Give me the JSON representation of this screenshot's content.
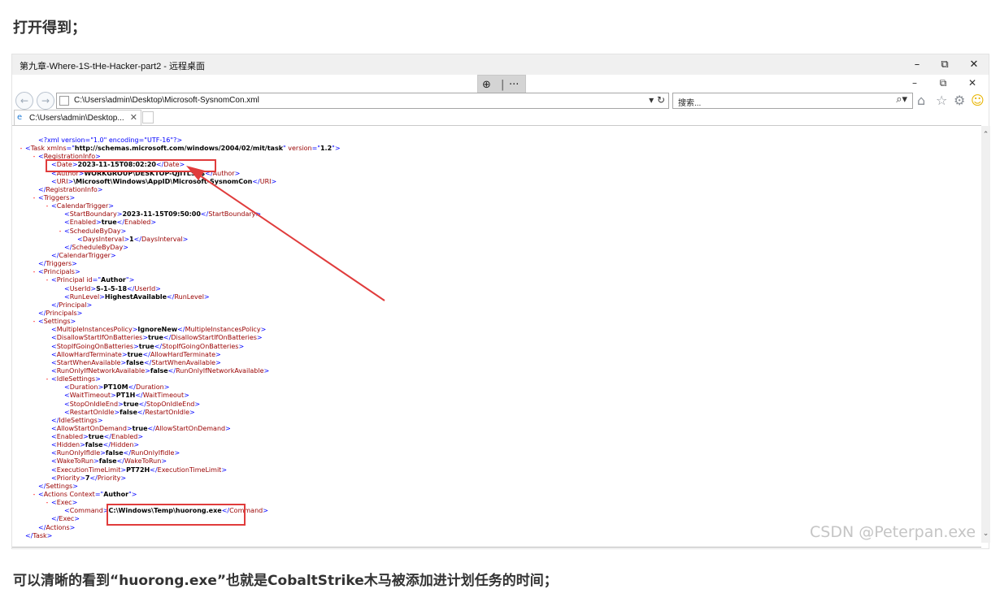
{
  "heading": "打开得到；",
  "footer": "可以清晰的看到“huorong.exe”也就是CobaltStrike木马被添加进计划任务的时间；",
  "watermark": "CSDN @Peterpan.exe",
  "remote_desktop": {
    "title": "第九章-Where-1S-tHe-Hacker-part2 - 远程桌面",
    "controls": {
      "minimize": "–",
      "restore": "⧉",
      "close": "✕"
    },
    "toolbar": {
      "zoom_icon": "⊕",
      "separator": "|",
      "more": "···"
    }
  },
  "browser": {
    "controls": {
      "minimize": "–",
      "restore": "⧉",
      "close": "✕"
    },
    "address": "C:\\Users\\admin\\Desktop\\Microsoft-SysnomCon.xml",
    "search_placeholder": "搜索...",
    "tab_label": "C:\\Users\\admin\\Desktop...",
    "icons": [
      "back-icon",
      "forward-icon",
      "refresh-icon",
      "search-icon",
      "home-icon",
      "favorites-icon",
      "gear-icon",
      "smiley-icon"
    ]
  },
  "colors": {
    "tag": "#990000",
    "bracket": "#0000ff",
    "marker": "#ff0000",
    "highlight": "#e03c3c"
  },
  "xml_lines": [
    {
      "indent": 1,
      "marker": "",
      "segs": [
        [
          "pi",
          "<?xml version=\"1.0\" encoding=\"UTF-16\"?>"
        ]
      ]
    },
    {
      "indent": 0,
      "marker": "-",
      "segs": [
        [
          "br",
          "<"
        ],
        [
          "tag",
          "Task xmlns"
        ],
        [
          "br",
          "=\""
        ],
        [
          "val",
          "http://schemas.microsoft.com/windows/2004/02/mit/task"
        ],
        [
          "br",
          "\" "
        ],
        [
          "tag",
          "version"
        ],
        [
          "br",
          "=\""
        ],
        [
          "val",
          "1.2"
        ],
        [
          "br",
          "\">"
        ]
      ]
    },
    {
      "indent": 1,
      "marker": "-",
      "segs": [
        [
          "br",
          "<"
        ],
        [
          "tag",
          "RegistrationInfo"
        ],
        [
          "br",
          ">"
        ]
      ]
    },
    {
      "indent": 2,
      "marker": "",
      "segs": [
        [
          "br",
          "<"
        ],
        [
          "tag",
          "Date"
        ],
        [
          "br",
          ">"
        ],
        [
          "val",
          "2023-11-15T08:02:20"
        ],
        [
          "br",
          "</"
        ],
        [
          "tag",
          "Date"
        ],
        [
          "br",
          ">"
        ]
      ]
    },
    {
      "indent": 2,
      "marker": "",
      "segs": [
        [
          "br",
          "<"
        ],
        [
          "tag",
          "Author"
        ],
        [
          "br",
          ">"
        ],
        [
          "val",
          "WORKGROUP\\DESKTOP-QJITLSB$"
        ],
        [
          "br",
          "</"
        ],
        [
          "tag",
          "Author"
        ],
        [
          "br",
          ">"
        ]
      ]
    },
    {
      "indent": 2,
      "marker": "",
      "segs": [
        [
          "br",
          "<"
        ],
        [
          "tag",
          "URI"
        ],
        [
          "br",
          ">"
        ],
        [
          "val",
          "\\Microsoft\\Windows\\AppID\\Microsoft-SysnomCon"
        ],
        [
          "br",
          "</"
        ],
        [
          "tag",
          "URI"
        ],
        [
          "br",
          ">"
        ]
      ]
    },
    {
      "indent": 1,
      "marker": "",
      "segs": [
        [
          "br",
          "</"
        ],
        [
          "tag",
          "RegistrationInfo"
        ],
        [
          "br",
          ">"
        ]
      ]
    },
    {
      "indent": 1,
      "marker": "-",
      "segs": [
        [
          "br",
          "<"
        ],
        [
          "tag",
          "Triggers"
        ],
        [
          "br",
          ">"
        ]
      ]
    },
    {
      "indent": 2,
      "marker": "-",
      "segs": [
        [
          "br",
          "<"
        ],
        [
          "tag",
          "CalendarTrigger"
        ],
        [
          "br",
          ">"
        ]
      ]
    },
    {
      "indent": 3,
      "marker": "",
      "segs": [
        [
          "br",
          "<"
        ],
        [
          "tag",
          "StartBoundary"
        ],
        [
          "br",
          ">"
        ],
        [
          "val",
          "2023-11-15T09:50:00"
        ],
        [
          "br",
          "</"
        ],
        [
          "tag",
          "StartBoundary"
        ],
        [
          "br",
          ">"
        ]
      ]
    },
    {
      "indent": 3,
      "marker": "",
      "segs": [
        [
          "br",
          "<"
        ],
        [
          "tag",
          "Enabled"
        ],
        [
          "br",
          ">"
        ],
        [
          "val",
          "true"
        ],
        [
          "br",
          "</"
        ],
        [
          "tag",
          "Enabled"
        ],
        [
          "br",
          ">"
        ]
      ]
    },
    {
      "indent": 3,
      "marker": "-",
      "segs": [
        [
          "br",
          "<"
        ],
        [
          "tag",
          "ScheduleByDay"
        ],
        [
          "br",
          ">"
        ]
      ]
    },
    {
      "indent": 4,
      "marker": "",
      "segs": [
        [
          "br",
          "<"
        ],
        [
          "tag",
          "DaysInterval"
        ],
        [
          "br",
          ">"
        ],
        [
          "val",
          "1"
        ],
        [
          "br",
          "</"
        ],
        [
          "tag",
          "DaysInterval"
        ],
        [
          "br",
          ">"
        ]
      ]
    },
    {
      "indent": 3,
      "marker": "",
      "segs": [
        [
          "br",
          "</"
        ],
        [
          "tag",
          "ScheduleByDay"
        ],
        [
          "br",
          ">"
        ]
      ]
    },
    {
      "indent": 2,
      "marker": "",
      "segs": [
        [
          "br",
          "</"
        ],
        [
          "tag",
          "CalendarTrigger"
        ],
        [
          "br",
          ">"
        ]
      ]
    },
    {
      "indent": 1,
      "marker": "",
      "segs": [
        [
          "br",
          "</"
        ],
        [
          "tag",
          "Triggers"
        ],
        [
          "br",
          ">"
        ]
      ]
    },
    {
      "indent": 1,
      "marker": "-",
      "segs": [
        [
          "br",
          "<"
        ],
        [
          "tag",
          "Principals"
        ],
        [
          "br",
          ">"
        ]
      ]
    },
    {
      "indent": 2,
      "marker": "-",
      "segs": [
        [
          "br",
          "<"
        ],
        [
          "tag",
          "Principal id"
        ],
        [
          "br",
          "=\""
        ],
        [
          "val",
          "Author"
        ],
        [
          "br",
          "\">"
        ]
      ]
    },
    {
      "indent": 3,
      "marker": "",
      "segs": [
        [
          "br",
          "<"
        ],
        [
          "tag",
          "UserId"
        ],
        [
          "br",
          ">"
        ],
        [
          "val",
          "S-1-5-18"
        ],
        [
          "br",
          "</"
        ],
        [
          "tag",
          "UserId"
        ],
        [
          "br",
          ">"
        ]
      ]
    },
    {
      "indent": 3,
      "marker": "",
      "segs": [
        [
          "br",
          "<"
        ],
        [
          "tag",
          "RunLevel"
        ],
        [
          "br",
          ">"
        ],
        [
          "val",
          "HighestAvailable"
        ],
        [
          "br",
          "</"
        ],
        [
          "tag",
          "RunLevel"
        ],
        [
          "br",
          ">"
        ]
      ]
    },
    {
      "indent": 2,
      "marker": "",
      "segs": [
        [
          "br",
          "</"
        ],
        [
          "tag",
          "Principal"
        ],
        [
          "br",
          ">"
        ]
      ]
    },
    {
      "indent": 1,
      "marker": "",
      "segs": [
        [
          "br",
          "</"
        ],
        [
          "tag",
          "Principals"
        ],
        [
          "br",
          ">"
        ]
      ]
    },
    {
      "indent": 1,
      "marker": "-",
      "segs": [
        [
          "br",
          "<"
        ],
        [
          "tag",
          "Settings"
        ],
        [
          "br",
          ">"
        ]
      ]
    },
    {
      "indent": 2,
      "marker": "",
      "segs": [
        [
          "br",
          "<"
        ],
        [
          "tag",
          "MultipleInstancesPolicy"
        ],
        [
          "br",
          ">"
        ],
        [
          "val",
          "IgnoreNew"
        ],
        [
          "br",
          "</"
        ],
        [
          "tag",
          "MultipleInstancesPolicy"
        ],
        [
          "br",
          ">"
        ]
      ]
    },
    {
      "indent": 2,
      "marker": "",
      "segs": [
        [
          "br",
          "<"
        ],
        [
          "tag",
          "DisallowStartIfOnBatteries"
        ],
        [
          "br",
          ">"
        ],
        [
          "val",
          "true"
        ],
        [
          "br",
          "</"
        ],
        [
          "tag",
          "DisallowStartIfOnBatteries"
        ],
        [
          "br",
          ">"
        ]
      ]
    },
    {
      "indent": 2,
      "marker": "",
      "segs": [
        [
          "br",
          "<"
        ],
        [
          "tag",
          "StopIfGoingOnBatteries"
        ],
        [
          "br",
          ">"
        ],
        [
          "val",
          "true"
        ],
        [
          "br",
          "</"
        ],
        [
          "tag",
          "StopIfGoingOnBatteries"
        ],
        [
          "br",
          ">"
        ]
      ]
    },
    {
      "indent": 2,
      "marker": "",
      "segs": [
        [
          "br",
          "<"
        ],
        [
          "tag",
          "AllowHardTerminate"
        ],
        [
          "br",
          ">"
        ],
        [
          "val",
          "true"
        ],
        [
          "br",
          "</"
        ],
        [
          "tag",
          "AllowHardTerminate"
        ],
        [
          "br",
          ">"
        ]
      ]
    },
    {
      "indent": 2,
      "marker": "",
      "segs": [
        [
          "br",
          "<"
        ],
        [
          "tag",
          "StartWhenAvailable"
        ],
        [
          "br",
          ">"
        ],
        [
          "val",
          "false"
        ],
        [
          "br",
          "</"
        ],
        [
          "tag",
          "StartWhenAvailable"
        ],
        [
          "br",
          ">"
        ]
      ]
    },
    {
      "indent": 2,
      "marker": "",
      "segs": [
        [
          "br",
          "<"
        ],
        [
          "tag",
          "RunOnlyIfNetworkAvailable"
        ],
        [
          "br",
          ">"
        ],
        [
          "val",
          "false"
        ],
        [
          "br",
          "</"
        ],
        [
          "tag",
          "RunOnlyIfNetworkAvailable"
        ],
        [
          "br",
          ">"
        ]
      ]
    },
    {
      "indent": 2,
      "marker": "-",
      "segs": [
        [
          "br",
          "<"
        ],
        [
          "tag",
          "IdleSettings"
        ],
        [
          "br",
          ">"
        ]
      ]
    },
    {
      "indent": 3,
      "marker": "",
      "segs": [
        [
          "br",
          "<"
        ],
        [
          "tag",
          "Duration"
        ],
        [
          "br",
          ">"
        ],
        [
          "val",
          "PT10M"
        ],
        [
          "br",
          "</"
        ],
        [
          "tag",
          "Duration"
        ],
        [
          "br",
          ">"
        ]
      ]
    },
    {
      "indent": 3,
      "marker": "",
      "segs": [
        [
          "br",
          "<"
        ],
        [
          "tag",
          "WaitTimeout"
        ],
        [
          "br",
          ">"
        ],
        [
          "val",
          "PT1H"
        ],
        [
          "br",
          "</"
        ],
        [
          "tag",
          "WaitTimeout"
        ],
        [
          "br",
          ">"
        ]
      ]
    },
    {
      "indent": 3,
      "marker": "",
      "segs": [
        [
          "br",
          "<"
        ],
        [
          "tag",
          "StopOnIdleEnd"
        ],
        [
          "br",
          ">"
        ],
        [
          "val",
          "true"
        ],
        [
          "br",
          "</"
        ],
        [
          "tag",
          "StopOnIdleEnd"
        ],
        [
          "br",
          ">"
        ]
      ]
    },
    {
      "indent": 3,
      "marker": "",
      "segs": [
        [
          "br",
          "<"
        ],
        [
          "tag",
          "RestartOnIdle"
        ],
        [
          "br",
          ">"
        ],
        [
          "val",
          "false"
        ],
        [
          "br",
          "</"
        ],
        [
          "tag",
          "RestartOnIdle"
        ],
        [
          "br",
          ">"
        ]
      ]
    },
    {
      "indent": 2,
      "marker": "",
      "segs": [
        [
          "br",
          "</"
        ],
        [
          "tag",
          "IdleSettings"
        ],
        [
          "br",
          ">"
        ]
      ]
    },
    {
      "indent": 2,
      "marker": "",
      "segs": [
        [
          "br",
          "<"
        ],
        [
          "tag",
          "AllowStartOnDemand"
        ],
        [
          "br",
          ">"
        ],
        [
          "val",
          "true"
        ],
        [
          "br",
          "</"
        ],
        [
          "tag",
          "AllowStartOnDemand"
        ],
        [
          "br",
          ">"
        ]
      ]
    },
    {
      "indent": 2,
      "marker": "",
      "segs": [
        [
          "br",
          "<"
        ],
        [
          "tag",
          "Enabled"
        ],
        [
          "br",
          ">"
        ],
        [
          "val",
          "true"
        ],
        [
          "br",
          "</"
        ],
        [
          "tag",
          "Enabled"
        ],
        [
          "br",
          ">"
        ]
      ]
    },
    {
      "indent": 2,
      "marker": "",
      "segs": [
        [
          "br",
          "<"
        ],
        [
          "tag",
          "Hidden"
        ],
        [
          "br",
          ">"
        ],
        [
          "val",
          "false"
        ],
        [
          "br",
          "</"
        ],
        [
          "tag",
          "Hidden"
        ],
        [
          "br",
          ">"
        ]
      ]
    },
    {
      "indent": 2,
      "marker": "",
      "segs": [
        [
          "br",
          "<"
        ],
        [
          "tag",
          "RunOnlyIfIdle"
        ],
        [
          "br",
          ">"
        ],
        [
          "val",
          "false"
        ],
        [
          "br",
          "</"
        ],
        [
          "tag",
          "RunOnlyIfIdle"
        ],
        [
          "br",
          ">"
        ]
      ]
    },
    {
      "indent": 2,
      "marker": "",
      "segs": [
        [
          "br",
          "<"
        ],
        [
          "tag",
          "WakeToRun"
        ],
        [
          "br",
          ">"
        ],
        [
          "val",
          "false"
        ],
        [
          "br",
          "</"
        ],
        [
          "tag",
          "WakeToRun"
        ],
        [
          "br",
          ">"
        ]
      ]
    },
    {
      "indent": 2,
      "marker": "",
      "segs": [
        [
          "br",
          "<"
        ],
        [
          "tag",
          "ExecutionTimeLimit"
        ],
        [
          "br",
          ">"
        ],
        [
          "val",
          "PT72H"
        ],
        [
          "br",
          "</"
        ],
        [
          "tag",
          "ExecutionTimeLimit"
        ],
        [
          "br",
          ">"
        ]
      ]
    },
    {
      "indent": 2,
      "marker": "",
      "segs": [
        [
          "br",
          "<"
        ],
        [
          "tag",
          "Priority"
        ],
        [
          "br",
          ">"
        ],
        [
          "val",
          "7"
        ],
        [
          "br",
          "</"
        ],
        [
          "tag",
          "Priority"
        ],
        [
          "br",
          ">"
        ]
      ]
    },
    {
      "indent": 1,
      "marker": "",
      "segs": [
        [
          "br",
          "</"
        ],
        [
          "tag",
          "Settings"
        ],
        [
          "br",
          ">"
        ]
      ]
    },
    {
      "indent": 1,
      "marker": "-",
      "segs": [
        [
          "br",
          "<"
        ],
        [
          "tag",
          "Actions Context"
        ],
        [
          "br",
          "=\""
        ],
        [
          "val",
          "Author"
        ],
        [
          "br",
          "\">"
        ]
      ]
    },
    {
      "indent": 2,
      "marker": "-",
      "segs": [
        [
          "br",
          "<"
        ],
        [
          "tag",
          "Exec"
        ],
        [
          "br",
          ">"
        ]
      ]
    },
    {
      "indent": 3,
      "marker": "",
      "segs": [
        [
          "br",
          "<"
        ],
        [
          "tag",
          "Command"
        ],
        [
          "br",
          ">"
        ],
        [
          "val",
          "C:\\Windows\\Temp\\huorong.exe"
        ],
        [
          "br",
          "</"
        ],
        [
          "tag",
          "Command"
        ],
        [
          "br",
          ">"
        ]
      ]
    },
    {
      "indent": 2,
      "marker": "",
      "segs": [
        [
          "br",
          "</"
        ],
        [
          "tag",
          "Exec"
        ],
        [
          "br",
          ">"
        ]
      ]
    },
    {
      "indent": 1,
      "marker": "",
      "segs": [
        [
          "br",
          "</"
        ],
        [
          "tag",
          "Actions"
        ],
        [
          "br",
          ">"
        ]
      ]
    },
    {
      "indent": 0,
      "marker": "",
      "segs": [
        [
          "br",
          "</"
        ],
        [
          "tag",
          "Task"
        ],
        [
          "br",
          ">"
        ]
      ]
    }
  ]
}
